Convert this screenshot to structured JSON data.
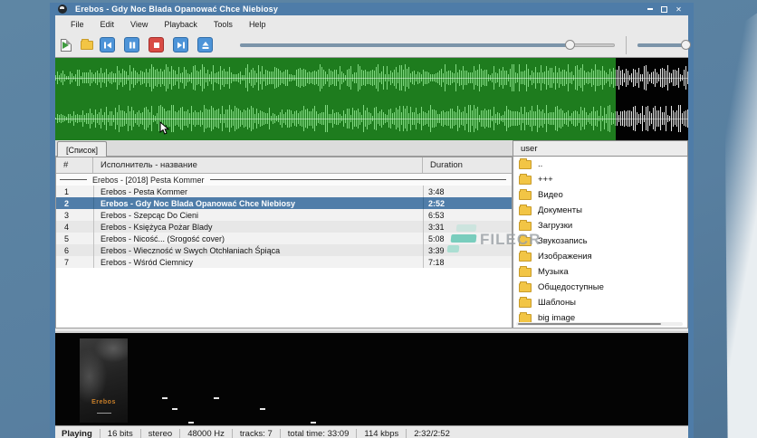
{
  "window": {
    "title": "Erebos - Gdy Noc Blada Opanować Chce Niebiosy",
    "controls": [
      "minimize",
      "maximize",
      "close"
    ]
  },
  "menu": {
    "items": [
      "File",
      "Edit",
      "View",
      "Playback",
      "Tools",
      "Help"
    ]
  },
  "toolbar": {
    "buttons": [
      "add-file",
      "add-folder",
      "previous",
      "pause",
      "stop",
      "next",
      "eject"
    ],
    "progress_fraction": 0.88,
    "volume_fraction": 0.93
  },
  "waveform": {
    "played_fraction": 0.886,
    "bg_played": "#1e7c1e",
    "bg_remaining": "#020202",
    "wave_color_played": "#7fd87f",
    "wave_color_remaining": "#e2e2e2"
  },
  "playlist": {
    "tab": "[Список]",
    "columns": [
      "#",
      "Исполнитель - название",
      "Duration"
    ],
    "group_header": "Erebos - [2018] Pesta Kommer",
    "tracks": [
      {
        "num": "1",
        "title": "Erebos - Pesta Kommer",
        "duration": "3:48",
        "selected": false
      },
      {
        "num": "2",
        "title": "Erebos - Gdy Noc Blada Opanować Chce Niebiosy",
        "duration": "2:52",
        "selected": true
      },
      {
        "num": "3",
        "title": "Erebos - Szepcąc Do Cieni",
        "duration": "6:53",
        "selected": false
      },
      {
        "num": "4",
        "title": "Erebos - Księżyca Pożar Blady",
        "duration": "3:31",
        "selected": false
      },
      {
        "num": "5",
        "title": "Erebos - Nicość... (Srogość cover)",
        "duration": "5:08",
        "selected": false
      },
      {
        "num": "6",
        "title": "Erebos - Wieczność w Swych Otchłaniach Śpiąca",
        "duration": "3:39",
        "selected": false
      },
      {
        "num": "7",
        "title": "Erebos - Wśród Ciemnicy",
        "duration": "7:18",
        "selected": false
      }
    ]
  },
  "file_browser": {
    "header": "user",
    "folders": [
      "..",
      "+++",
      "Видео",
      "Документы",
      "Загрузки",
      "Звукозапись",
      "Изображения",
      "Музыка",
      "Общедоступные",
      "Шаблоны",
      "big image"
    ]
  },
  "album_art": {
    "label": "Erebos"
  },
  "status_bar": {
    "items": [
      "Playing",
      "16 bits",
      "stereo",
      "48000 Hz",
      "tracks: 7",
      "total time: 33:09",
      "114 kbps",
      "2:32/2:52"
    ]
  },
  "watermark": {
    "text": "FILECR"
  },
  "colors": {
    "titlebar": "#4e7ca8",
    "selection": "#4f7da9",
    "folder_yellow": "#f2c545",
    "watermark_teal": "#5cc5b0",
    "transport_blue": "#4d94d8",
    "stop_red": "#d94b45"
  }
}
